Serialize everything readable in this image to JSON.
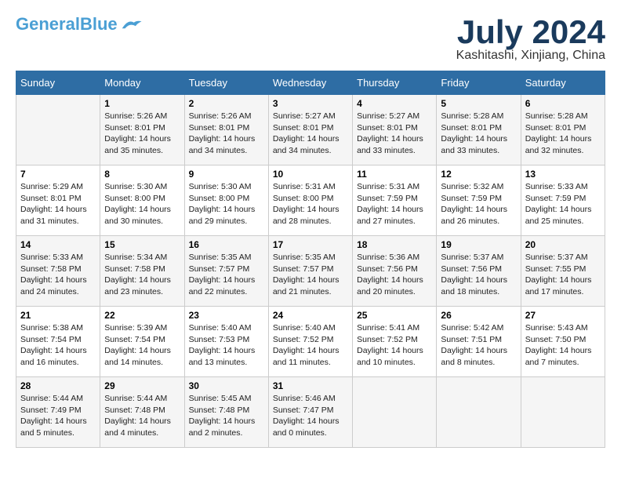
{
  "logo": {
    "line1": "General",
    "line2": "Blue"
  },
  "title": "July 2024",
  "location": "Kashitashi, Xinjiang, China",
  "headers": [
    "Sunday",
    "Monday",
    "Tuesday",
    "Wednesday",
    "Thursday",
    "Friday",
    "Saturday"
  ],
  "weeks": [
    [
      {
        "day": "",
        "info": ""
      },
      {
        "day": "1",
        "info": "Sunrise: 5:26 AM\nSunset: 8:01 PM\nDaylight: 14 hours\nand 35 minutes."
      },
      {
        "day": "2",
        "info": "Sunrise: 5:26 AM\nSunset: 8:01 PM\nDaylight: 14 hours\nand 34 minutes."
      },
      {
        "day": "3",
        "info": "Sunrise: 5:27 AM\nSunset: 8:01 PM\nDaylight: 14 hours\nand 34 minutes."
      },
      {
        "day": "4",
        "info": "Sunrise: 5:27 AM\nSunset: 8:01 PM\nDaylight: 14 hours\nand 33 minutes."
      },
      {
        "day": "5",
        "info": "Sunrise: 5:28 AM\nSunset: 8:01 PM\nDaylight: 14 hours\nand 33 minutes."
      },
      {
        "day": "6",
        "info": "Sunrise: 5:28 AM\nSunset: 8:01 PM\nDaylight: 14 hours\nand 32 minutes."
      }
    ],
    [
      {
        "day": "7",
        "info": "Sunrise: 5:29 AM\nSunset: 8:01 PM\nDaylight: 14 hours\nand 31 minutes."
      },
      {
        "day": "8",
        "info": "Sunrise: 5:30 AM\nSunset: 8:00 PM\nDaylight: 14 hours\nand 30 minutes."
      },
      {
        "day": "9",
        "info": "Sunrise: 5:30 AM\nSunset: 8:00 PM\nDaylight: 14 hours\nand 29 minutes."
      },
      {
        "day": "10",
        "info": "Sunrise: 5:31 AM\nSunset: 8:00 PM\nDaylight: 14 hours\nand 28 minutes."
      },
      {
        "day": "11",
        "info": "Sunrise: 5:31 AM\nSunset: 7:59 PM\nDaylight: 14 hours\nand 27 minutes."
      },
      {
        "day": "12",
        "info": "Sunrise: 5:32 AM\nSunset: 7:59 PM\nDaylight: 14 hours\nand 26 minutes."
      },
      {
        "day": "13",
        "info": "Sunrise: 5:33 AM\nSunset: 7:59 PM\nDaylight: 14 hours\nand 25 minutes."
      }
    ],
    [
      {
        "day": "14",
        "info": "Sunrise: 5:33 AM\nSunset: 7:58 PM\nDaylight: 14 hours\nand 24 minutes."
      },
      {
        "day": "15",
        "info": "Sunrise: 5:34 AM\nSunset: 7:58 PM\nDaylight: 14 hours\nand 23 minutes."
      },
      {
        "day": "16",
        "info": "Sunrise: 5:35 AM\nSunset: 7:57 PM\nDaylight: 14 hours\nand 22 minutes."
      },
      {
        "day": "17",
        "info": "Sunrise: 5:35 AM\nSunset: 7:57 PM\nDaylight: 14 hours\nand 21 minutes."
      },
      {
        "day": "18",
        "info": "Sunrise: 5:36 AM\nSunset: 7:56 PM\nDaylight: 14 hours\nand 20 minutes."
      },
      {
        "day": "19",
        "info": "Sunrise: 5:37 AM\nSunset: 7:56 PM\nDaylight: 14 hours\nand 18 minutes."
      },
      {
        "day": "20",
        "info": "Sunrise: 5:37 AM\nSunset: 7:55 PM\nDaylight: 14 hours\nand 17 minutes."
      }
    ],
    [
      {
        "day": "21",
        "info": "Sunrise: 5:38 AM\nSunset: 7:54 PM\nDaylight: 14 hours\nand 16 minutes."
      },
      {
        "day": "22",
        "info": "Sunrise: 5:39 AM\nSunset: 7:54 PM\nDaylight: 14 hours\nand 14 minutes."
      },
      {
        "day": "23",
        "info": "Sunrise: 5:40 AM\nSunset: 7:53 PM\nDaylight: 14 hours\nand 13 minutes."
      },
      {
        "day": "24",
        "info": "Sunrise: 5:40 AM\nSunset: 7:52 PM\nDaylight: 14 hours\nand 11 minutes."
      },
      {
        "day": "25",
        "info": "Sunrise: 5:41 AM\nSunset: 7:52 PM\nDaylight: 14 hours\nand 10 minutes."
      },
      {
        "day": "26",
        "info": "Sunrise: 5:42 AM\nSunset: 7:51 PM\nDaylight: 14 hours\nand 8 minutes."
      },
      {
        "day": "27",
        "info": "Sunrise: 5:43 AM\nSunset: 7:50 PM\nDaylight: 14 hours\nand 7 minutes."
      }
    ],
    [
      {
        "day": "28",
        "info": "Sunrise: 5:44 AM\nSunset: 7:49 PM\nDaylight: 14 hours\nand 5 minutes."
      },
      {
        "day": "29",
        "info": "Sunrise: 5:44 AM\nSunset: 7:48 PM\nDaylight: 14 hours\nand 4 minutes."
      },
      {
        "day": "30",
        "info": "Sunrise: 5:45 AM\nSunset: 7:48 PM\nDaylight: 14 hours\nand 2 minutes."
      },
      {
        "day": "31",
        "info": "Sunrise: 5:46 AM\nSunset: 7:47 PM\nDaylight: 14 hours\nand 0 minutes."
      },
      {
        "day": "",
        "info": ""
      },
      {
        "day": "",
        "info": ""
      },
      {
        "day": "",
        "info": ""
      }
    ]
  ]
}
